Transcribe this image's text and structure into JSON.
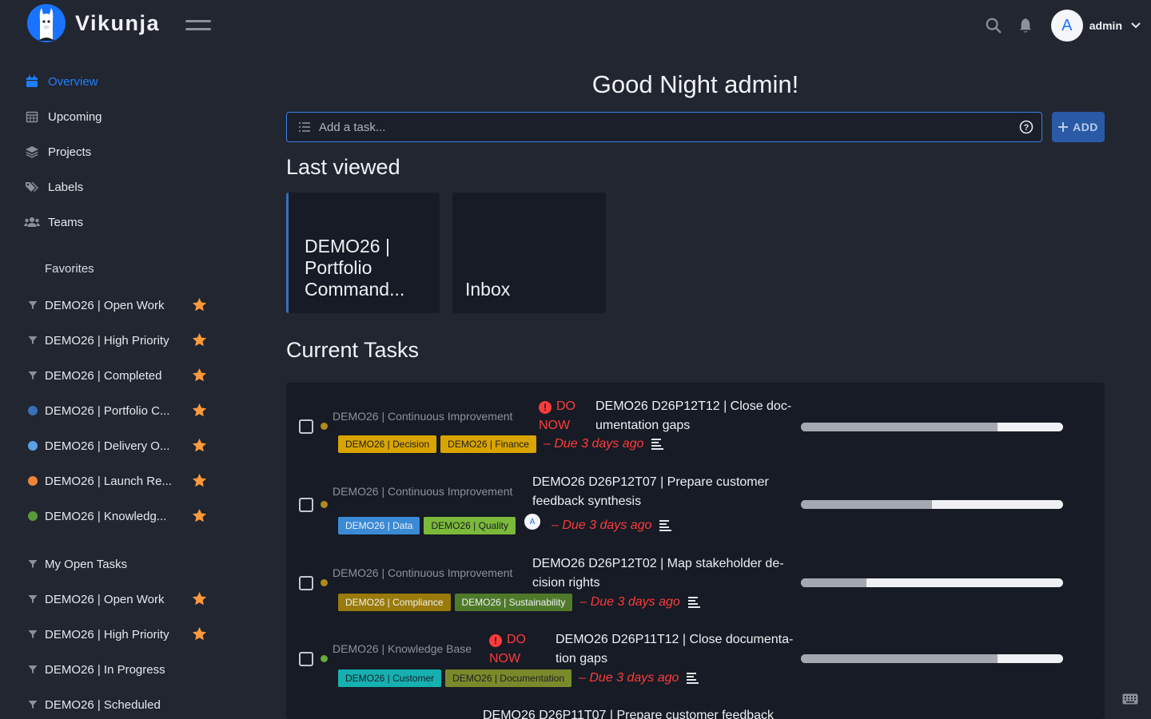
{
  "app": {
    "name": "Vikunja"
  },
  "user": {
    "initial": "A",
    "name": "admin"
  },
  "sidebar": {
    "nav": [
      {
        "label": "Overview",
        "icon": "calendar-icon",
        "active": true
      },
      {
        "label": "Upcoming",
        "icon": "calendar-grid-icon",
        "active": false
      },
      {
        "label": "Projects",
        "icon": "layers-icon",
        "active": false
      },
      {
        "label": "Labels",
        "icon": "tags-icon",
        "active": false
      },
      {
        "label": "Teams",
        "icon": "users-icon",
        "active": false
      }
    ],
    "favorites_title": "Favorites",
    "favorites": [
      {
        "label": "DEMO26 | Open Work",
        "kind": "filter"
      },
      {
        "label": "DEMO26 | High Priority",
        "kind": "filter"
      },
      {
        "label": "DEMO26 | Completed",
        "kind": "filter"
      },
      {
        "label": "DEMO26 | Portfolio C...",
        "kind": "dot",
        "color": "#3b6fb8"
      },
      {
        "label": "DEMO26 | Delivery O...",
        "kind": "dot",
        "color": "#5aa0e8"
      },
      {
        "label": "DEMO26 | Launch Re...",
        "kind": "dot",
        "color": "#f0833a"
      },
      {
        "label": "DEMO26 | Knowledg...",
        "kind": "dot",
        "color": "#5a9a3a"
      }
    ],
    "filters": [
      {
        "label": "My Open Tasks",
        "starred": false
      },
      {
        "label": "DEMO26 | Open Work",
        "starred": true
      },
      {
        "label": "DEMO26 | High Priority",
        "starred": true
      },
      {
        "label": "DEMO26 | In Progress",
        "starred": false
      },
      {
        "label": "DEMO26 | Scheduled",
        "starred": false
      }
    ]
  },
  "main": {
    "greeting": "Good Night admin!",
    "add_task": {
      "placeholder": "Add a task...",
      "button": "ADD"
    },
    "last_viewed_title": "Last viewed",
    "last_viewed": [
      {
        "title": "DEMO26 | Portfolio Command..."
      },
      {
        "title": "Inbox"
      }
    ],
    "current_tasks_title": "Current Tasks",
    "tasks": [
      {
        "project": "DEMO26 | Continuous Improvement",
        "project_color": "#b08a1a",
        "priority": "DO NOW",
        "title": "DEMO26 D26P12T12 | Close doc-umentation gaps",
        "labels": [
          {
            "text": "DEMO26 | Decision",
            "color": "#d9a400"
          },
          {
            "text": "DEMO26 | Finance",
            "color": "#d9a400"
          }
        ],
        "assignee": "",
        "due": "– Due 3 days ago",
        "progress": 0.75
      },
      {
        "project": "DEMO26 | Continuous Improvement",
        "project_color": "#b08a1a",
        "priority": "",
        "title": "DEMO26 D26P12T07 | Prepare customer feedback synthesis",
        "labels": [
          {
            "text": "DEMO26 | Data",
            "color": "#3a8ad6"
          },
          {
            "text": "DEMO26 | Quality",
            "color": "#7cb83a"
          }
        ],
        "assignee": "A",
        "due": "– Due 3 days ago",
        "progress": 0.5
      },
      {
        "project": "DEMO26 | Continuous Improvement",
        "project_color": "#b08a1a",
        "priority": "",
        "title": "DEMO26 D26P12T02 | Map stakeholder de-cision rights",
        "labels": [
          {
            "text": "DEMO26 | Compliance",
            "color": "#9a7a0a"
          },
          {
            "text": "DEMO26 | Sustainability",
            "color": "#4f7a2a"
          }
        ],
        "assignee": "",
        "due": "– Due 3 days ago",
        "progress": 0.25
      },
      {
        "project": "DEMO26 | Knowledge Base",
        "project_color": "#6aa83a",
        "priority": "DO NOW",
        "title": "DEMO26 D26P11T12 | Close documenta-tion gaps",
        "labels": [
          {
            "text": "DEMO26 | Customer",
            "color": "#15b0b0"
          },
          {
            "text": "DEMO26 | Documentation",
            "color": "#7a8a2a"
          }
        ],
        "assignee": "",
        "due": "– Due 3 days ago",
        "progress": 0.75
      },
      {
        "project": "",
        "project_color": "#6aa83a",
        "priority": "",
        "title": "DEMO26 D26P11T07 | Prepare customer feedback",
        "labels": [],
        "assignee": "",
        "due": "",
        "progress": 0
      }
    ]
  }
}
